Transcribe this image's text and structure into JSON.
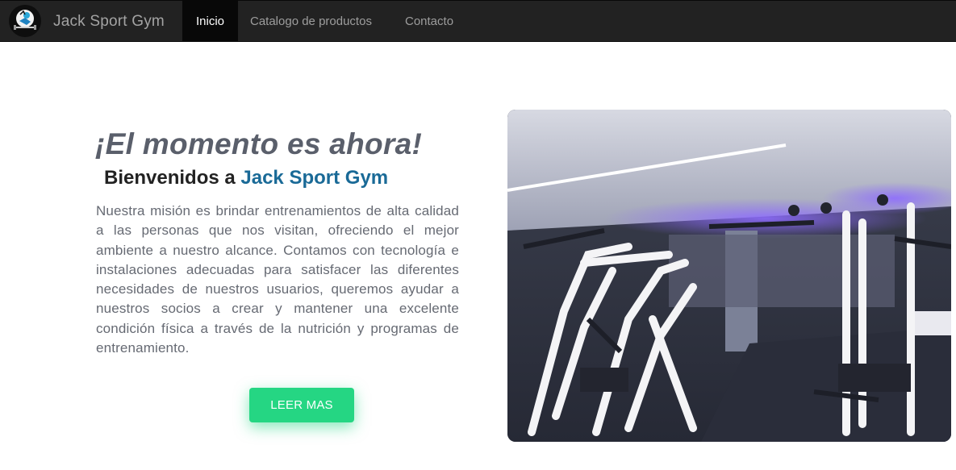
{
  "navbar": {
    "brand": "Jack Sport Gym",
    "items": [
      {
        "label": "Inicio",
        "active": true
      },
      {
        "label": "Catalogo de productos",
        "active": false
      },
      {
        "label": "Contacto",
        "active": false
      }
    ]
  },
  "hero": {
    "title": "¡El momento es ahora!",
    "subtitle_prefix": "Bienvenidos a ",
    "subtitle_accent": "Jack Sport Gym",
    "description": "Nuestra misión es brindar entrenamientos de alta calidad a las personas que nos visitan, ofreciendo el mejor ambiente a nuestro alcance. Contamos con tecnología e instalaciones adecuadas para satisfacer las diferentes necesidades de nuestros usuarios, queremos ayudar a nuestros socios a crear y mantener una excelente condición física a través de la nutrición y programas de entrenamiento.",
    "button_label": "LEER MAS"
  },
  "colors": {
    "navbar_bg": "#222222",
    "accent_blue": "#1a6a97",
    "button_green": "#25d683"
  },
  "icons": {
    "logo": "gym-logo-icon"
  }
}
